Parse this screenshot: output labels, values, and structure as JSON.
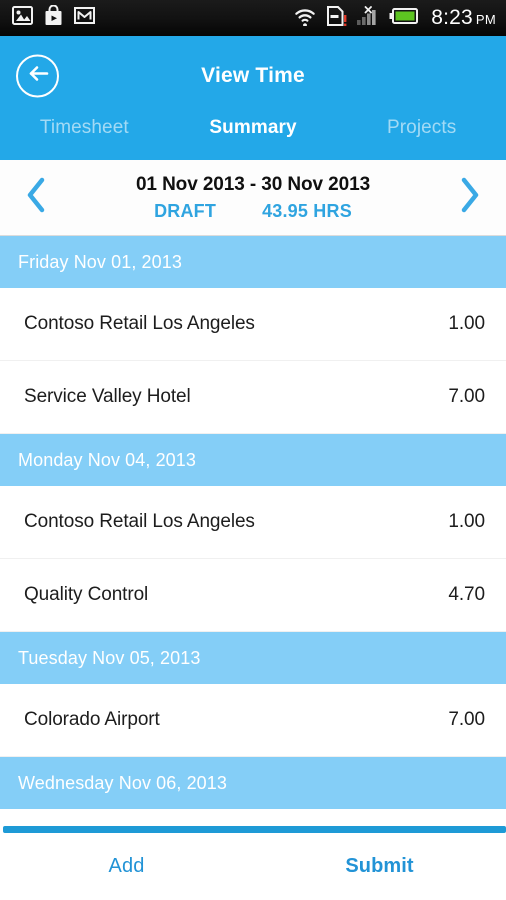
{
  "status_bar": {
    "icons_left": [
      "photos-icon",
      "play-store-icon",
      "gmail-icon"
    ],
    "icons_right": [
      "wifi-icon",
      "sd-card-warning-icon",
      "signal-no-service-icon",
      "battery-icon"
    ],
    "time": "8:23",
    "ampm": "PM"
  },
  "appbar": {
    "back_icon": "back-arrow-icon",
    "title": "View Time",
    "accent_color": "#23a8e8"
  },
  "tabs": [
    {
      "label": "Timesheet",
      "active": false
    },
    {
      "label": "Summary",
      "active": true
    },
    {
      "label": "Projects",
      "active": false
    }
  ],
  "date_nav": {
    "prev_icon": "chevron-left-icon",
    "next_icon": "chevron-right-icon",
    "range": "01 Nov 2013 - 30 Nov 2013",
    "status": "DRAFT",
    "hours": "43.95 HRS",
    "accent_color": "#2fa4e0"
  },
  "sections": [
    {
      "date_label": "Friday Nov 01, 2013",
      "entries": [
        {
          "name": "Contoso Retail Los Angeles",
          "hours": "1.00"
        },
        {
          "name": "Service Valley Hotel",
          "hours": "7.00"
        }
      ]
    },
    {
      "date_label": "Monday Nov 04, 2013",
      "entries": [
        {
          "name": "Contoso Retail Los Angeles",
          "hours": "1.00"
        },
        {
          "name": "Quality Control",
          "hours": "4.70"
        }
      ]
    },
    {
      "date_label": "Tuesday Nov 05, 2013",
      "entries": [
        {
          "name": "Colorado Airport",
          "hours": "7.00"
        }
      ]
    },
    {
      "date_label": "Wednesday Nov 06, 2013",
      "entries": []
    }
  ],
  "bottom_bar": {
    "add_label": "Add",
    "submit_label": "Submit",
    "accent_color": "#2293d6"
  },
  "colors": {
    "header_blue": "#23a8e8",
    "section_blue": "#84cef7",
    "link_blue": "#2293d6",
    "glow_blue": "#1e9ad6"
  }
}
